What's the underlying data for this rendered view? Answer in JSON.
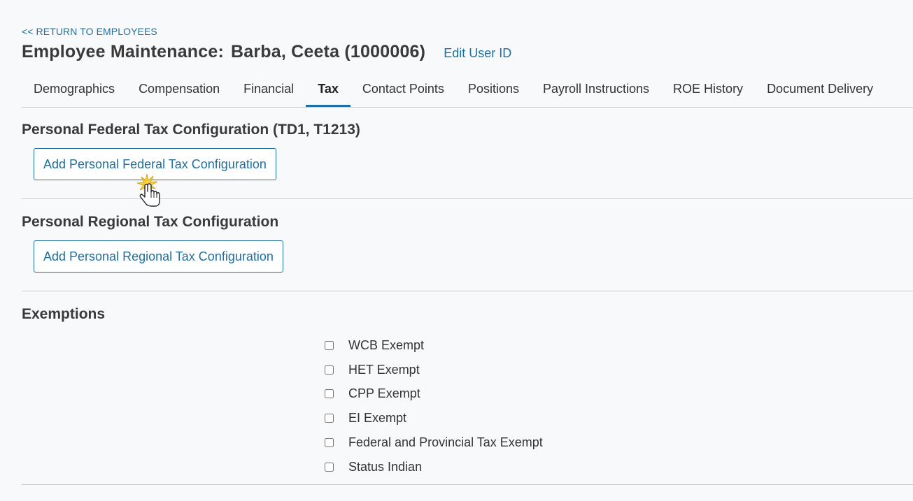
{
  "nav": {
    "return_link": "<< RETURN TO EMPLOYEES"
  },
  "header": {
    "title_prefix": "Employee Maintenance:",
    "employee_name": "Barba, Ceeta (1000006)",
    "edit_user_id": "Edit User ID"
  },
  "tabs": [
    {
      "label": "Demographics",
      "active": false
    },
    {
      "label": "Compensation",
      "active": false
    },
    {
      "label": "Financial",
      "active": false
    },
    {
      "label": "Tax",
      "active": true
    },
    {
      "label": "Contact Points",
      "active": false
    },
    {
      "label": "Positions",
      "active": false
    },
    {
      "label": "Payroll Instructions",
      "active": false
    },
    {
      "label": "ROE History",
      "active": false
    },
    {
      "label": "Document Delivery",
      "active": false
    }
  ],
  "federal": {
    "title": "Personal Federal Tax Configuration (TD1, T1213)",
    "add_button": "Add Personal Federal Tax Configuration"
  },
  "regional": {
    "title": "Personal Regional Tax Configuration",
    "add_button": "Add Personal Regional Tax Configuration"
  },
  "exemptions": {
    "title": "Exemptions",
    "items": [
      {
        "label": "WCB Exempt",
        "checked": false
      },
      {
        "label": "HET Exempt",
        "checked": false
      },
      {
        "label": "CPP Exempt",
        "checked": false
      },
      {
        "label": "EI Exempt",
        "checked": false
      },
      {
        "label": "Federal and Provincial Tax Exempt",
        "checked": false
      },
      {
        "label": "Status Indian",
        "checked": false
      }
    ]
  },
  "colors": {
    "accent": "#1f6f9f",
    "divider": "#c8cdd2",
    "background": "#f7f9fb"
  },
  "icons": {
    "cursor": "hand-pointer-click-icon"
  }
}
